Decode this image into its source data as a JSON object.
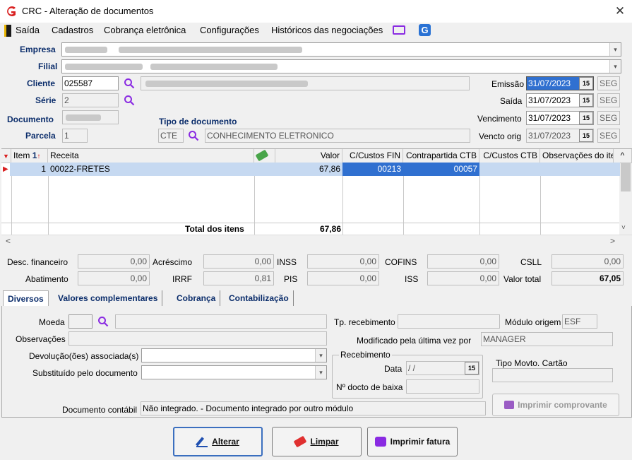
{
  "window": {
    "title": "CRC - Alteração de documentos",
    "close": "✕"
  },
  "menu": [
    "Saída",
    "Cadastros",
    "Cobrança eletrônica",
    "Configurações",
    "Históricos das negociações"
  ],
  "header": {
    "empresa_label": "Empresa",
    "filial_label": "Filial",
    "cliente_label": "Cliente",
    "cliente_value": "025587",
    "serie_label": "Série",
    "serie_value": "2",
    "documento_label": "Documento",
    "parcela_label": "Parcela",
    "parcela_value": "1",
    "tipo_label": "Tipo de documento",
    "tipo_code": "CTE",
    "tipo_desc": "CONHECIMENTO ELETRONICO",
    "emissao_label": "Emissão",
    "emissao_value": "31/07/2023",
    "emissao_dow": "SEG",
    "saida_label": "Saída",
    "saida_value": "31/07/2023",
    "saida_dow": "SEG",
    "vencimento_label": "Vencimento",
    "vencimento_value": "31/07/2023",
    "vencimento_dow": "SEG",
    "vencto_orig_label": "Vencto orig",
    "vencto_orig_value": "31/07/2023",
    "vencto_orig_dow": "SEG",
    "date_btn": "15"
  },
  "grid": {
    "columns": [
      "Item",
      "Receita",
      "",
      "Valor",
      "C/Custos FIN",
      "Contrapartida CTB",
      "C/Custos CTB",
      "Observações do item"
    ],
    "row": {
      "item": "1",
      "receita": "00022-FRETES",
      "valor": "67,86",
      "cc_fin": "00213",
      "contrapartida": "00057"
    },
    "total_label": "Total dos itens",
    "total_value": "67,86"
  },
  "summary": {
    "desc_fin_label": "Desc. financeiro",
    "desc_fin": "0,00",
    "acrescimo_label": "Acréscimo",
    "acrescimo": "0,00",
    "inss_label": "INSS",
    "inss": "0,00",
    "cofins_label": "COFINS",
    "cofins": "0,00",
    "csll_label": "CSLL",
    "csll": "0,00",
    "abatimento_label": "Abatimento",
    "abatimento": "0,00",
    "irrf_label": "IRRF",
    "irrf": "0,81",
    "pis_label": "PIS",
    "pis": "0,00",
    "iss_label": "ISS",
    "iss": "0,00",
    "valor_total_label": "Valor total",
    "valor_total": "67,05"
  },
  "tabs": [
    "Diversos",
    "Valores complementares",
    "Cobrança",
    "Contabilização"
  ],
  "diversos": {
    "moeda_label": "Moeda",
    "observacoes_label": "Observações",
    "devolucoes_label": "Devolução(ões) associada(s)",
    "substituido_label": "Substituído pelo documento",
    "tp_recebimento_label": "Tp. recebimento",
    "modulo_origem_label": "Módulo origem",
    "modulo_origem": "ESF",
    "modificado_label": "Modificado pela última vez por",
    "modificado": "MANAGER",
    "recebimento_group": "Recebimento",
    "data_label": "Data",
    "data_value": "/ /",
    "nro_baixa_label": "Nº docto de baixa",
    "tipo_movto_label": "Tipo Movto. Cartão",
    "doc_contabil_label": "Documento contábil",
    "doc_contabil_value": "Não integrado.  - Documento integrado por outro módulo",
    "imprimir_comprovante": "Imprimir comprovante"
  },
  "buttons": {
    "alterar": "Alterar",
    "limpar": "Limpar",
    "imprimir_fatura": "Imprimir fatura"
  },
  "colors": {
    "brand": "#d92020",
    "label_blue": "#0b2d6b",
    "selection": "#3070d0",
    "search": "#8a2be2"
  }
}
